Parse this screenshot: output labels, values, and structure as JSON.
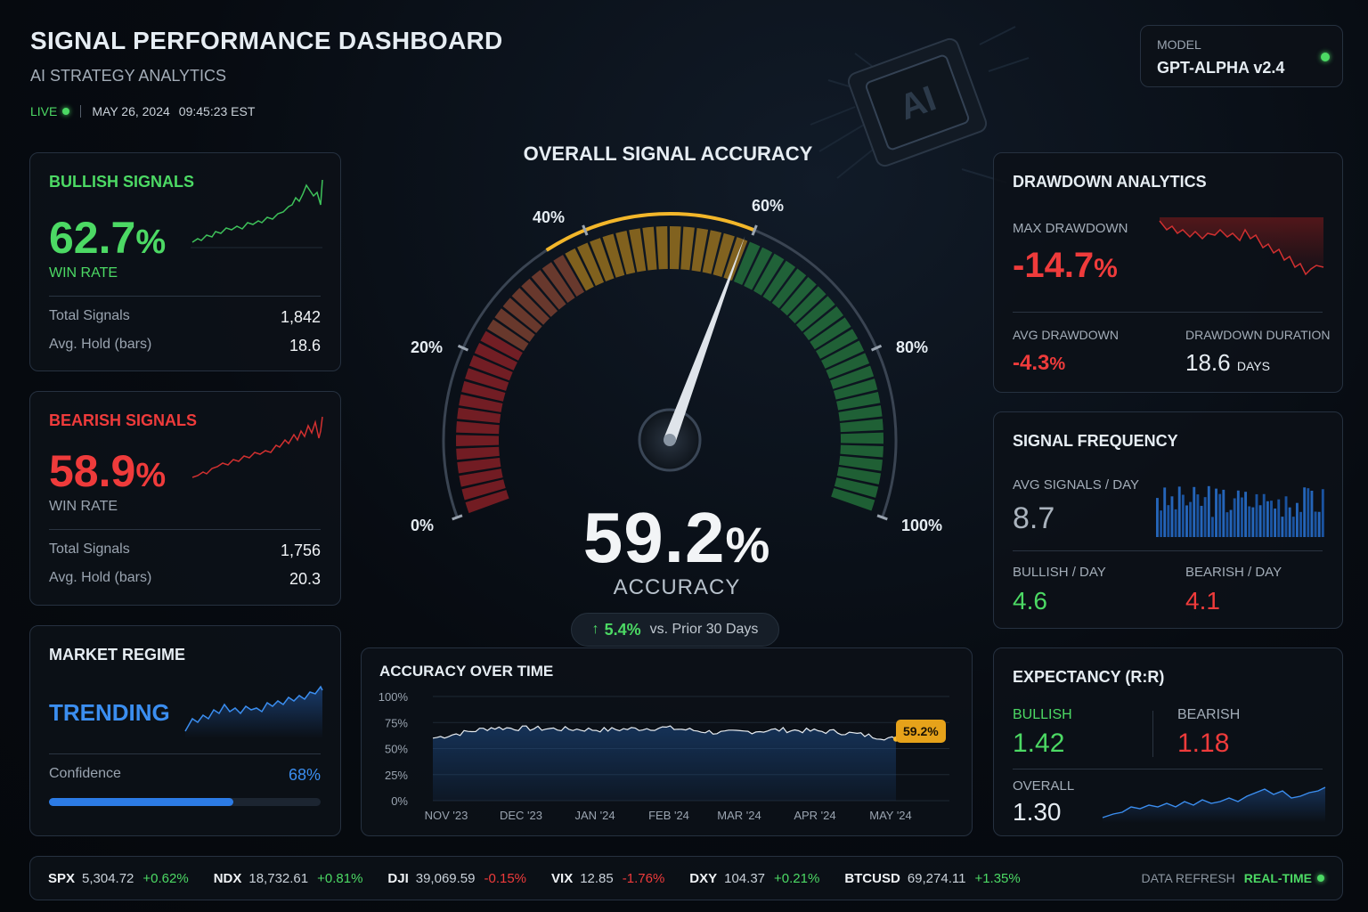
{
  "header": {
    "title": "SIGNAL PERFORMANCE DASHBOARD",
    "subtitle": "AI STRATEGY ANALYTICS",
    "live_label": "LIVE",
    "date": "MAY 26, 2024",
    "time": "09:45:23 EST"
  },
  "model": {
    "label": "MODEL",
    "name": "GPT-ALPHA v2.4",
    "status_color": "#4cd964"
  },
  "bullish": {
    "title": "BULLISH SIGNALS",
    "win_rate": "62.7",
    "pct_sign": "%",
    "win_rate_label": "WIN RATE",
    "total_signals_label": "Total Signals",
    "total_signals": "1,842",
    "avg_hold_label": "Avg. Hold (bars)",
    "avg_hold": "18.6",
    "color": "#4cd964"
  },
  "bearish": {
    "title": "BEARISH SIGNALS",
    "win_rate": "58.9",
    "pct_sign": "%",
    "win_rate_label": "WIN RATE",
    "total_signals_label": "Total Signals",
    "total_signals": "1,756",
    "avg_hold_label": "Avg. Hold (bars)",
    "avg_hold": "20.3",
    "color": "#ef3b3b"
  },
  "regime": {
    "title": "MARKET REGIME",
    "state": "TRENDING",
    "confidence_label": "Confidence",
    "confidence": "68%",
    "confidence_fraction": 0.68
  },
  "gauge": {
    "title": "OVERALL SIGNAL ACCURACY",
    "tick_labels": [
      "0%",
      "20%",
      "40%",
      "60%",
      "80%",
      "100%"
    ],
    "value": 59.2,
    "value_text": "59.2",
    "pct_sign": "%",
    "label": "ACCURACY",
    "delta_arrow": "↑",
    "delta": "5.4%",
    "delta_text": "vs. Prior 30 Days"
  },
  "accuracy_over_time": {
    "title": "ACCURACY OVER TIME",
    "current_badge": "59.2%"
  },
  "drawdown": {
    "title": "DRAWDOWN ANALYTICS",
    "max_label": "MAX DRAWDOWN",
    "max_value": "-14.7",
    "pct_sign": "%",
    "avg_label": "AVG DRAWDOWN",
    "avg_value": "-4.3",
    "duration_label": "DRAWDOWN DURATION",
    "duration_value": "18.6",
    "duration_unit": "DAYS"
  },
  "frequency": {
    "title": "SIGNAL FREQUENCY",
    "avg_label": "AVG SIGNALS / DAY",
    "avg_value": "8.7",
    "bull_label": "BULLISH / DAY",
    "bull_value": "4.6",
    "bear_label": "BEARISH / DAY",
    "bear_value": "4.1"
  },
  "expectancy": {
    "title": "EXPECTANCY (R:R)",
    "bull_label": "BULLISH",
    "bull_value": "1.42",
    "bear_label": "BEARISH",
    "bear_value": "1.18",
    "overall_label": "OVERALL",
    "overall_value": "1.30"
  },
  "ticker": {
    "items": [
      {
        "symbol": "SPX",
        "price": "5,304.72",
        "change": "+0.62%",
        "direction": "up"
      },
      {
        "symbol": "NDX",
        "price": "18,732.61",
        "change": "+0.81%",
        "direction": "up"
      },
      {
        "symbol": "DJI",
        "price": "39,069.59",
        "change": "-0.15%",
        "direction": "down"
      },
      {
        "symbol": "VIX",
        "price": "12.85",
        "change": "-1.76%",
        "direction": "down"
      },
      {
        "symbol": "DXY",
        "price": "104.37",
        "change": "+0.21%",
        "direction": "up"
      },
      {
        "symbol": "BTCUSD",
        "price": "69,274.11",
        "change": "+1.35%",
        "direction": "up"
      }
    ],
    "refresh_label": "DATA REFRESH",
    "refresh_value": "REAL-TIME"
  },
  "chart_data": [
    {
      "type": "line",
      "x": [
        "NOV '23",
        "DEC '23",
        "JAN '24",
        "FEB '24",
        "MAR '24",
        "APR '24",
        "MAY '24"
      ],
      "series": [
        {
          "values": [
            60,
            70,
            69,
            68,
            70,
            65,
            68,
            66,
            59.2
          ]
        }
      ],
      "ylim": [
        0,
        100
      ],
      "yticks": [
        "100%",
        "75%",
        "50%",
        "25%",
        "0%"
      ],
      "grid": true
    }
  ]
}
